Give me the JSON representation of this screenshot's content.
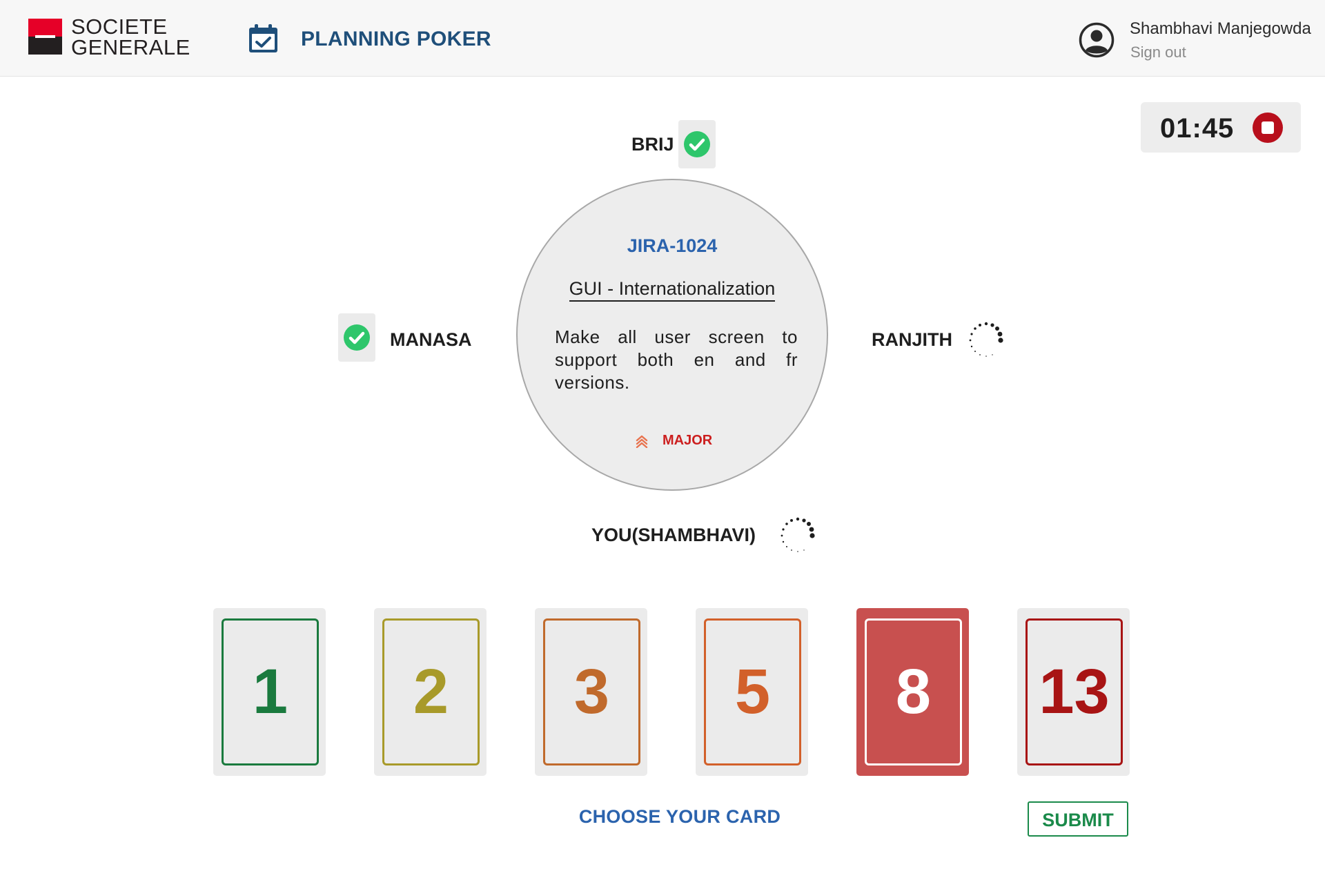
{
  "header": {
    "logo_line1": "SOCIETE",
    "logo_line2": "GENERALE",
    "app_title": "PLANNING POKER",
    "user_name": "Shambhavi Manjegowda",
    "sign_out": "Sign out"
  },
  "timer": {
    "value": "01:45"
  },
  "players": {
    "top": {
      "name": "BRIJ",
      "status": "voted"
    },
    "left": {
      "name": "MANASA",
      "status": "voted"
    },
    "right": {
      "name": "RANJITH",
      "status": "waiting"
    },
    "bottom": {
      "name": "YOU(SHAMBHAVI)",
      "status": "waiting"
    }
  },
  "ticket": {
    "id": "JIRA-1024",
    "title": "GUI - Internationalization",
    "description": "Make all user screen to support both en and fr versions.",
    "priority": "MAJOR"
  },
  "cards": [
    {
      "value": "1",
      "color": "#1a7a3e",
      "selected": false
    },
    {
      "value": "2",
      "color": "#a89a2a",
      "selected": false
    },
    {
      "value": "3",
      "color": "#c06a2c",
      "selected": false
    },
    {
      "value": "5",
      "color": "#d2602a",
      "selected": false
    },
    {
      "value": "8",
      "color": "#c8504f",
      "selected": true
    },
    {
      "value": "13",
      "color": "#a81414",
      "selected": false
    }
  ],
  "choose_label": "CHOOSE YOUR CARD",
  "submit_label": "SUBMIT",
  "colors": {
    "accent_blue": "#2b63ad",
    "check_green": "#2ec66b",
    "stop_red": "#b80f1c",
    "priority_red": "#cc1f1f"
  },
  "icons": {
    "calendar": "calendar-check-icon",
    "user": "user-circle-icon",
    "stop": "stop-icon",
    "check": "check-circle-icon",
    "spinner": "loading-spinner-icon",
    "priority": "double-chevron-up-icon"
  }
}
